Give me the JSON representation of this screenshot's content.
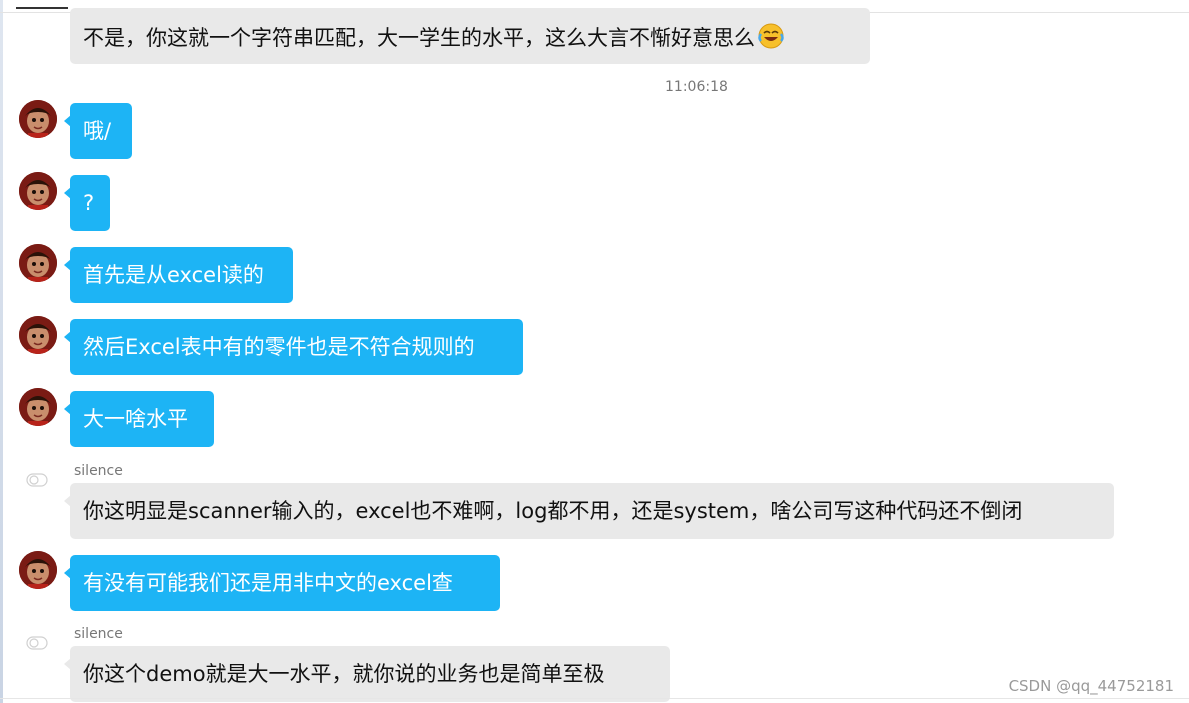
{
  "timestamp": "11:06:18",
  "messages": [
    {
      "type": "gray",
      "text": "不是，你这就一个字符串匹配，大一学生的水平，这么大言不惭好意思么",
      "emoji": "laughing-tears-emoji"
    },
    {
      "type": "blue",
      "text": "哦/"
    },
    {
      "type": "blue",
      "text": "?"
    },
    {
      "type": "blue",
      "text": "首先是从excel读的"
    },
    {
      "type": "blue",
      "text": "然后Excel表中有的零件也是不符合规则的"
    },
    {
      "type": "blue",
      "text": "大一啥水平"
    },
    {
      "type": "gray",
      "sender": "silence",
      "text": "你这明显是scanner输入的，excel也不难啊，log都不用，还是system，啥公司写这种代码还不倒闭"
    },
    {
      "type": "blue",
      "text": "有没有可能我们还是用非中文的excel查"
    },
    {
      "type": "gray",
      "sender": "silence",
      "text": "你这个demo就是大一水平，就你说的业务也是简单至极"
    }
  ],
  "watermark": "CSDN @qq_44752181",
  "colors": {
    "self_bubble": "#1db4f5",
    "other_bubble": "#e9e9e9",
    "avatar_bg": "#7a1b14"
  }
}
